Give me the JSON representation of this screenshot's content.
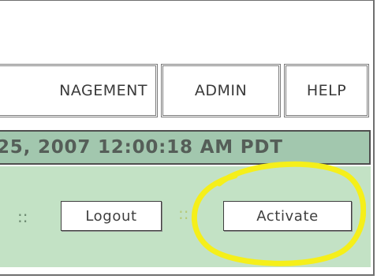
{
  "nav": {
    "tabs": [
      {
        "label": "NAGEMENT"
      },
      {
        "label": "ADMIN"
      },
      {
        "label": "HELP"
      }
    ]
  },
  "datebar": {
    "text": "25, 2007 12:00:18 AM PDT"
  },
  "actions": {
    "separator": "::",
    "logout_label": "Logout",
    "activate_label": "Activate"
  },
  "colors": {
    "datebar_bg": "#a2c7ae",
    "actionbar_bg": "#c3e2c5",
    "highlight": "#f5ef1a"
  }
}
